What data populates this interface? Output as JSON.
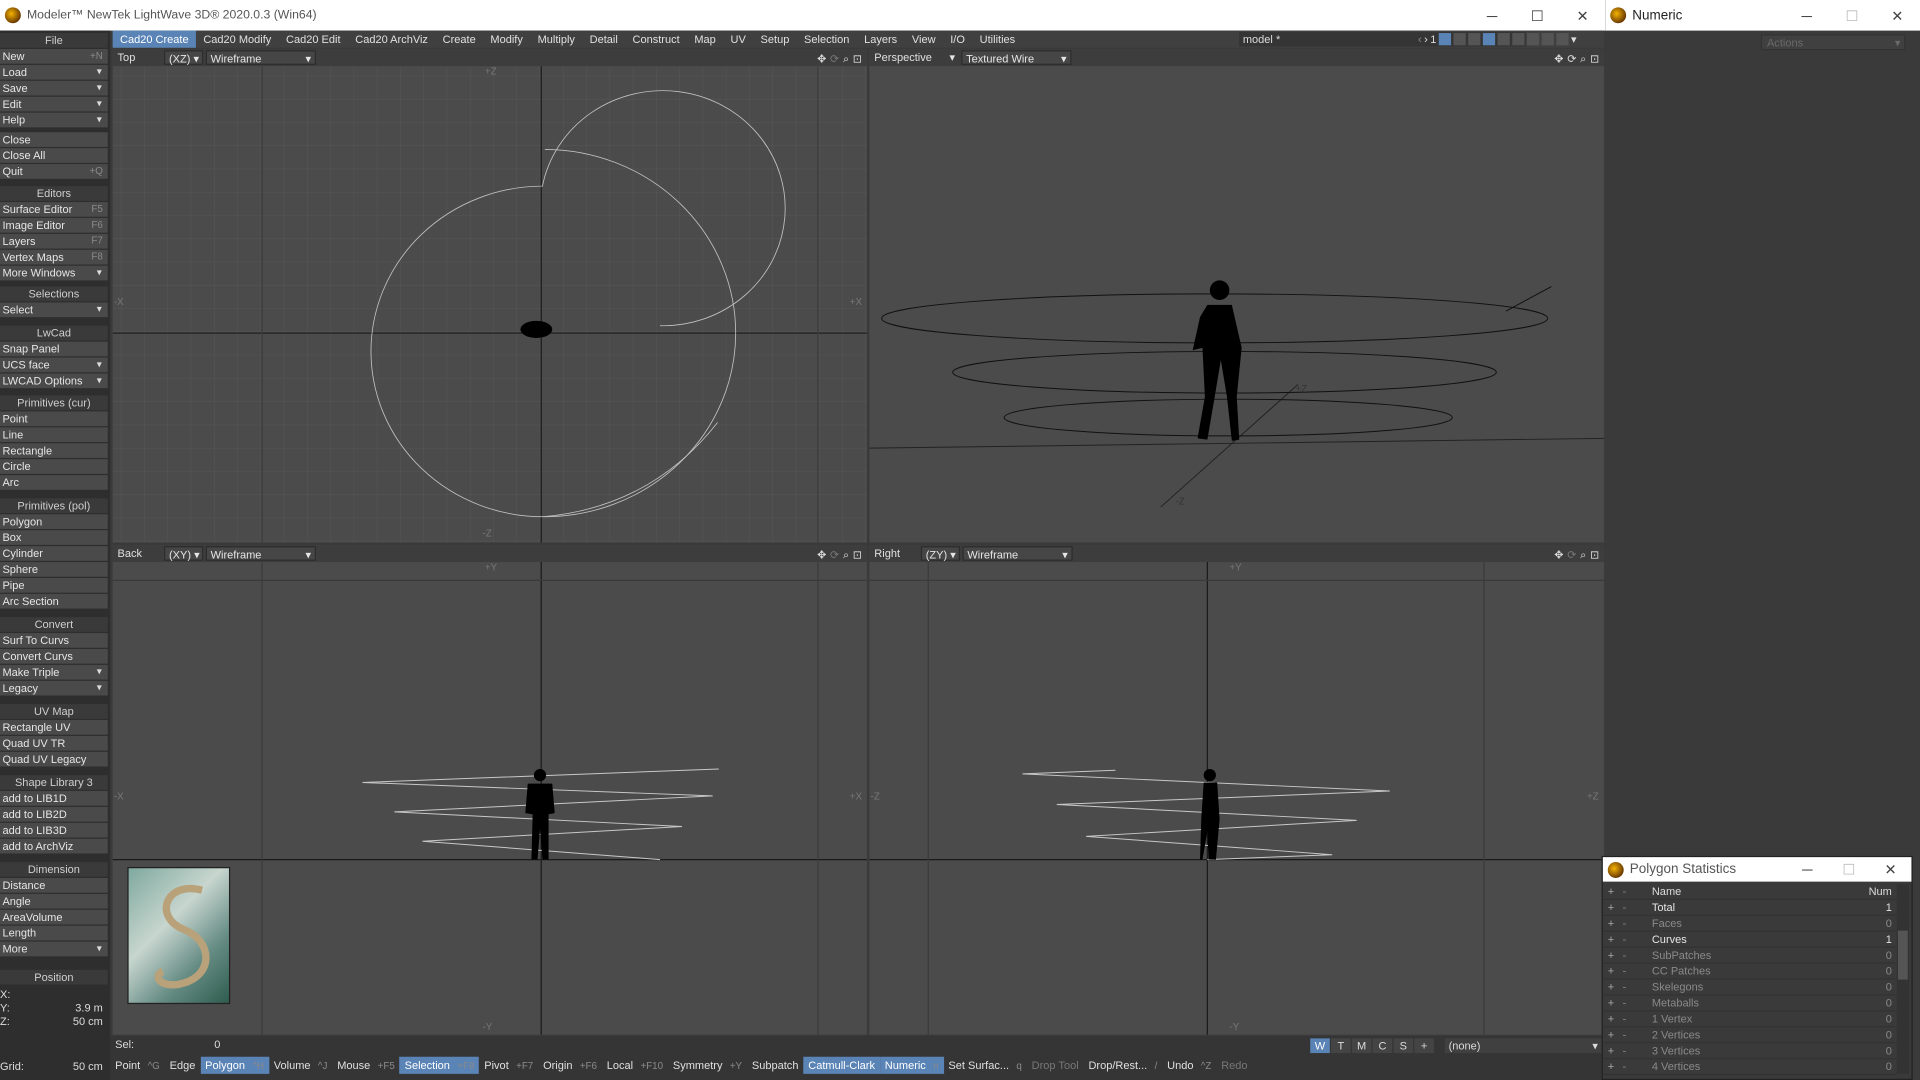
{
  "app": {
    "title": "Modeler™ NewTek LightWave 3D® 2020.0.3 (Win64)"
  },
  "menu": {
    "file_header": "File",
    "file": [
      {
        "label": "New",
        "shortcut": "+N"
      },
      {
        "label": "Load",
        "dd": true
      },
      {
        "label": "Save",
        "dd": true
      },
      {
        "label": "Edit",
        "dd": true
      },
      {
        "label": "Help",
        "dd": true
      }
    ],
    "file2": [
      {
        "label": "Close"
      },
      {
        "label": "Close All"
      },
      {
        "label": "Quit",
        "shortcut": "+Q"
      }
    ],
    "editors_header": "Editors",
    "editors": [
      {
        "label": "Surface Editor",
        "shortcut": "F5"
      },
      {
        "label": "Image Editor",
        "shortcut": "F6"
      },
      {
        "label": "Layers",
        "shortcut": "F7"
      },
      {
        "label": "Vertex Maps",
        "shortcut": "F8"
      },
      {
        "label": "More Windows",
        "dd": true
      }
    ],
    "selections_header": "Selections",
    "selections": [
      {
        "label": "Select",
        "dd": true
      }
    ],
    "lwcad_header": "LwCad",
    "lwcad": [
      {
        "label": "Snap Panel"
      },
      {
        "label": "UCS face",
        "dd": true
      },
      {
        "label": "LWCAD Options",
        "dd": true
      }
    ],
    "prim_cur_header": "Primitives (cur)",
    "prim_cur": [
      {
        "label": "Point"
      },
      {
        "label": "Line"
      },
      {
        "label": "Rectangle"
      },
      {
        "label": "Circle"
      },
      {
        "label": "Arc"
      }
    ],
    "prim_pol_header": "Primitives (pol)",
    "prim_pol": [
      {
        "label": "Polygon"
      },
      {
        "label": "Box"
      },
      {
        "label": "Cylinder"
      },
      {
        "label": "Sphere"
      },
      {
        "label": "Pipe"
      },
      {
        "label": "Arc Section"
      }
    ],
    "convert_header": "Convert",
    "convert": [
      {
        "label": "Surf To Curvs"
      },
      {
        "label": "Convert Curvs"
      },
      {
        "label": "Make Triple",
        "dd": true
      },
      {
        "label": "Legacy",
        "dd": true
      }
    ],
    "uvmap_header": "UV Map",
    "uvmap": [
      {
        "label": "Rectangle UV"
      },
      {
        "label": "Quad UV TR"
      },
      {
        "label": "Quad UV Legacy"
      }
    ],
    "shapelib_header": "Shape Library 3",
    "shapelib": [
      {
        "label": "add to LIB1D"
      },
      {
        "label": "add to LIB2D"
      },
      {
        "label": "add to LIB3D"
      },
      {
        "label": "add to ArchViz"
      }
    ],
    "dimension_header": "Dimension",
    "dimension": [
      {
        "label": "Distance"
      },
      {
        "label": "Angle"
      },
      {
        "label": "AreaVolume"
      },
      {
        "label": "Length"
      },
      {
        "label": "More",
        "dd": true
      }
    ]
  },
  "position": {
    "header": "Position",
    "x_label": "X:",
    "y_label": "Y:",
    "y_value": "3.9 m",
    "z_label": "Z:",
    "z_value": "50 cm",
    "grid_label": "Grid:",
    "grid_value": "50 cm"
  },
  "tabs": [
    "Cad20 Create",
    "Cad20 Modify",
    "Cad20 Edit",
    "Cad20 ArchViz",
    "Create",
    "Modify",
    "Multiply",
    "Detail",
    "Construct",
    "Map",
    "UV",
    "Setup",
    "Selection",
    "Layers",
    "View",
    "I/O",
    "Utilities"
  ],
  "active_tab": "Cad20 Create",
  "model_select": "model *",
  "layer_number": "1",
  "viewports": {
    "tl": {
      "view": "Top",
      "axis": "(XZ)",
      "mode": "Wireframe",
      "labels": {
        "top": "+Z",
        "bottom": "-Z",
        "left": "-X",
        "right": "+X"
      }
    },
    "tr": {
      "view": "Perspective",
      "mode": "Textured Wire",
      "labels": {
        "z1": "+Z",
        "z2": "-Z"
      }
    },
    "bl": {
      "view": "Back",
      "axis": "(XY)",
      "mode": "Wireframe",
      "labels": {
        "top": "+Y",
        "bottom": "-Y",
        "left": "-X",
        "right": "+X"
      }
    },
    "br": {
      "view": "Right",
      "axis": "(ZY)",
      "mode": "Wireframe",
      "labels": {
        "top": "+Y",
        "bottom": "-Y",
        "left": "-Z",
        "right": "+Z"
      }
    }
  },
  "numeric": {
    "title": "Numeric",
    "actions": "Actions"
  },
  "polystats": {
    "title": "Polygon Statistics",
    "col_name": "Name",
    "col_num": "Num",
    "rows": [
      {
        "name": "Total",
        "num": "1",
        "bright": true
      },
      {
        "name": "Faces",
        "num": "0"
      },
      {
        "name": "Curves",
        "num": "1",
        "bright": true
      },
      {
        "name": "SubPatches",
        "num": "0"
      },
      {
        "name": "CC Patches",
        "num": "0"
      },
      {
        "name": "Skelegons",
        "num": "0"
      },
      {
        "name": "Metaballs",
        "num": "0"
      },
      {
        "name": "1 Vertex",
        "num": "0"
      },
      {
        "name": "2 Vertices",
        "num": "0"
      },
      {
        "name": "3 Vertices",
        "num": "0"
      },
      {
        "name": "4 Vertices",
        "num": "0"
      }
    ]
  },
  "status": {
    "sel_label": "Sel:",
    "sel_value": "0",
    "wtm": [
      "W",
      "T",
      "M",
      "C",
      "S",
      "+"
    ],
    "wtm_active": "W",
    "layer_select": "(none)"
  },
  "modes": [
    {
      "label": "Point",
      "sc": "^G"
    },
    {
      "label": "Edge",
      "sc": ""
    },
    {
      "label": "Polygon",
      "sc": "^H",
      "on": true
    },
    {
      "label": "Volume",
      "sc": "^J"
    },
    {
      "label": "Mouse",
      "sc": "+F5"
    },
    {
      "label": "Selection",
      "sc": "+F8",
      "on": true
    },
    {
      "label": "Pivot",
      "sc": "+F7"
    },
    {
      "label": "Origin",
      "sc": "+F6"
    },
    {
      "label": "Local",
      "sc": "+F10"
    },
    {
      "label": "Symmetry",
      "sc": "+Y"
    },
    {
      "label": "Subpatch",
      "sc": ""
    },
    {
      "label": "Catmull-Clark",
      "sc": "",
      "on": true
    },
    {
      "label": "Numeric",
      "sc": "n",
      "on": true
    },
    {
      "label": "Set Surfac...",
      "sc": "q"
    },
    {
      "label": "Drop Tool",
      "sc": "",
      "dim": true
    },
    {
      "label": "Drop/Rest...",
      "sc": "/"
    },
    {
      "label": "Undo",
      "sc": "^Z"
    },
    {
      "label": "Redo",
      "sc": "",
      "dim": true
    }
  ],
  "colors": {
    "accent": "#5a83b6",
    "panel": "#2e2e2e",
    "viewport": "#4b4b4b",
    "button": "#4a4a4a"
  }
}
